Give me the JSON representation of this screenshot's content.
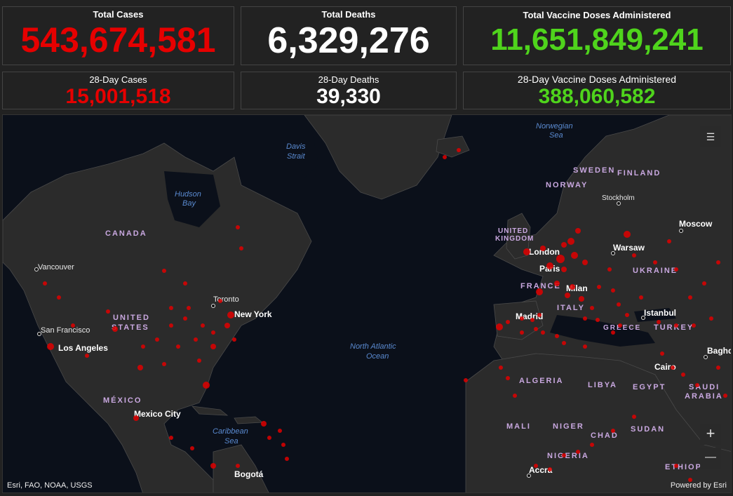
{
  "stats": {
    "total_cases": {
      "label": "Total Cases",
      "value": "543,674,581"
    },
    "total_deaths": {
      "label": "Total Deaths",
      "value": "6,329,276"
    },
    "total_vaccines": {
      "label": "Total Vaccine Doses Administered",
      "value": "11,651,849,241"
    },
    "cases_28": {
      "label": "28-Day Cases",
      "value": "15,001,518"
    },
    "deaths_28": {
      "label": "28-Day Deaths",
      "value": "39,330"
    },
    "vaccines_28": {
      "label": "28-Day Vaccine Doses Administered",
      "value": "388,060,582"
    }
  },
  "map": {
    "countries": {
      "canada": "CANADA",
      "united": "UNITED",
      "states": "STATES",
      "mexico": "MÉXICO",
      "uk1": "UNITED",
      "uk2": "KINGDOM",
      "france": "FRANCE",
      "italy": "ITALY",
      "ukraine": "UKRAINE",
      "sweden": "SWEDEN",
      "finland": "FINLAND",
      "norway": "NORWAY",
      "greece": "GREECE",
      "turkey": "TURKEY",
      "algeria": "ALGERIA",
      "libya": "LIBYA",
      "egypt": "EGYPT",
      "saudi1": "SAUDI",
      "saudi2": "ARABIA",
      "mali": "MALI",
      "niger": "NIGER",
      "chad": "CHAD",
      "sudan": "SUDAN",
      "nigeria": "NIGERIA",
      "ethiopia": "ETHIOP"
    },
    "cities": {
      "vancouver": "Vancouver",
      "toronto": "Toronto",
      "new_york": "New York",
      "san_francisco": "San Francisco",
      "los_angeles": "Los Angeles",
      "mexico_city": "Mexico City",
      "bogota": "Bogotá",
      "london": "London",
      "paris": "Paris",
      "milan": "Milan",
      "madrid": "Madrid",
      "warsaw": "Warsaw",
      "moscow": "Moscow",
      "stockholm": "Stockholm",
      "istanbul": "Istanbul",
      "cairo": "Cairo",
      "baghdad": "Baghd",
      "accra": "Accra"
    },
    "waters": {
      "hudson1": "Hudson",
      "hudson2": "Bay",
      "davis1": "Davis",
      "davis2": "Strait",
      "norw1": "Norwegian",
      "norw2": "Sea",
      "atl1": "North Atlantic",
      "atl2": "Ocean",
      "carib1": "Caribbean",
      "carib2": "Sea"
    },
    "attribution_left": "Esri, FAO, NOAA, USGS",
    "attribution_right": "Powered by Esri",
    "zoom_in": "+",
    "zoom_out": "—",
    "dot_color": "#e00000"
  }
}
